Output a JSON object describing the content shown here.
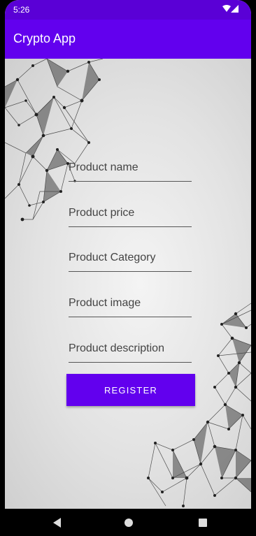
{
  "status_bar": {
    "time": "5:26"
  },
  "app_bar": {
    "title": "Crypto App"
  },
  "form": {
    "product_name": {
      "placeholder": "Product name",
      "value": ""
    },
    "product_price": {
      "placeholder": "Product price",
      "value": ""
    },
    "product_category": {
      "placeholder": "Product Category",
      "value": ""
    },
    "product_image": {
      "placeholder": "Product image",
      "value": ""
    },
    "product_description": {
      "placeholder": "Product description",
      "value": ""
    },
    "register_label": "REGISTER"
  },
  "colors": {
    "primary": "#6200ee",
    "primary_dark": "#5a00d6",
    "background": "#e6e6e6"
  },
  "icons": {
    "status": [
      "wifi-icon",
      "signal-icon"
    ],
    "nav": [
      "back-icon",
      "home-icon",
      "recent-apps-icon"
    ]
  }
}
